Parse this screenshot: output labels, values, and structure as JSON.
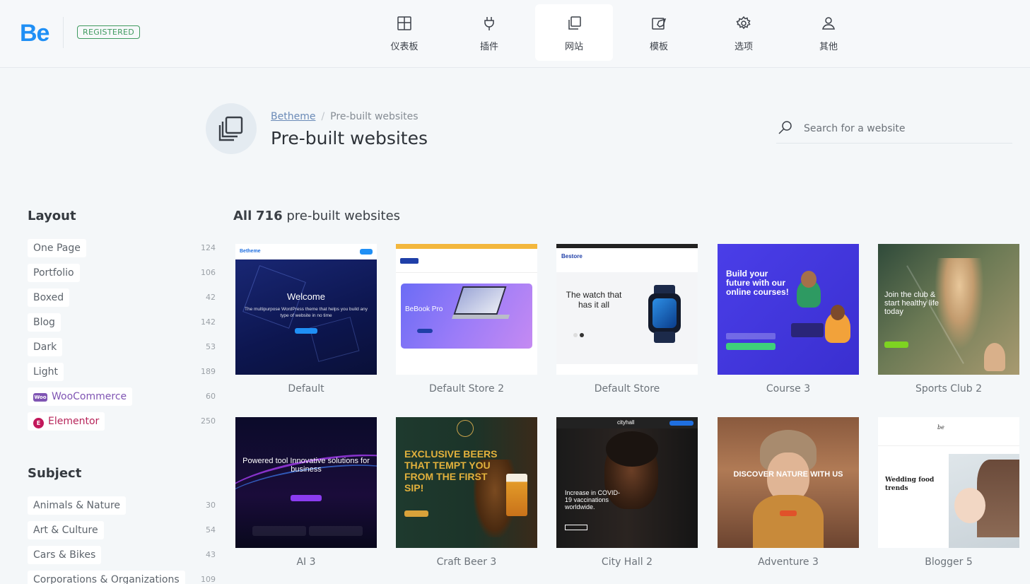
{
  "brand": {
    "logo": "Be",
    "badge": "REGISTERED"
  },
  "nav": [
    {
      "label": "仪表板",
      "icon": "dashboard-icon"
    },
    {
      "label": "插件",
      "icon": "plug-icon"
    },
    {
      "label": "网站",
      "icon": "websites-icon",
      "active": true
    },
    {
      "label": "模板",
      "icon": "template-icon"
    },
    {
      "label": "选项",
      "icon": "gear-icon"
    },
    {
      "label": "其他",
      "icon": "user-icon"
    }
  ],
  "header": {
    "breadcrumb_root": "Betheme",
    "breadcrumb_current": "Pre-built websites",
    "title": "Pre-built websites",
    "search_placeholder": "Search for a website"
  },
  "sidebar": {
    "layout_heading": "Layout",
    "layout": [
      {
        "label": "One Page",
        "count": "124"
      },
      {
        "label": "Portfolio",
        "count": "106"
      },
      {
        "label": "Boxed",
        "count": "42"
      },
      {
        "label": "Blog",
        "count": "142"
      },
      {
        "label": "Dark",
        "count": "53"
      },
      {
        "label": "Light",
        "count": "189"
      },
      {
        "label": "WooCommerce",
        "count": "60",
        "badge": "Woo"
      },
      {
        "label": "Elementor",
        "count": "250",
        "badge": "E"
      }
    ],
    "subject_heading": "Subject",
    "subject": [
      {
        "label": "Animals & Nature",
        "count": "30"
      },
      {
        "label": "Art & Culture",
        "count": "54"
      },
      {
        "label": "Cars & Bikes",
        "count": "43"
      },
      {
        "label": "Corporations & Organizations",
        "count": "109"
      }
    ]
  },
  "grid": {
    "heading_prefix": "All",
    "total": "716",
    "heading_suffix": "pre-built websites",
    "websites": [
      {
        "name": "Default",
        "headline": "Welcome",
        "sub": "The multipurpose WordPress theme that helps you build any type of website in no time"
      },
      {
        "name": "Default Store 2",
        "headline": "BeBook Pro"
      },
      {
        "name": "Default Store",
        "headline": "The watch that has it all"
      },
      {
        "name": "Course 3",
        "headline": "Build your future with our online courses!"
      },
      {
        "name": "Sports Club 2",
        "headline": "Join the club & start healthy life today"
      },
      {
        "name": "AI 3",
        "headline": "Powered tool Innovative solutions for business"
      },
      {
        "name": "Craft Beer 3",
        "headline": "EXCLUSIVE BEERS THAT TEMPT YOU FROM THE FIRST SIP!"
      },
      {
        "name": "City Hall 2",
        "headline": "Increase in COVID-19 vaccinations worldwide."
      },
      {
        "name": "Adventure 3",
        "headline": "DISCOVER NATURE WITH US"
      },
      {
        "name": "Blogger 5",
        "headline": "Wedding food trends"
      }
    ]
  }
}
